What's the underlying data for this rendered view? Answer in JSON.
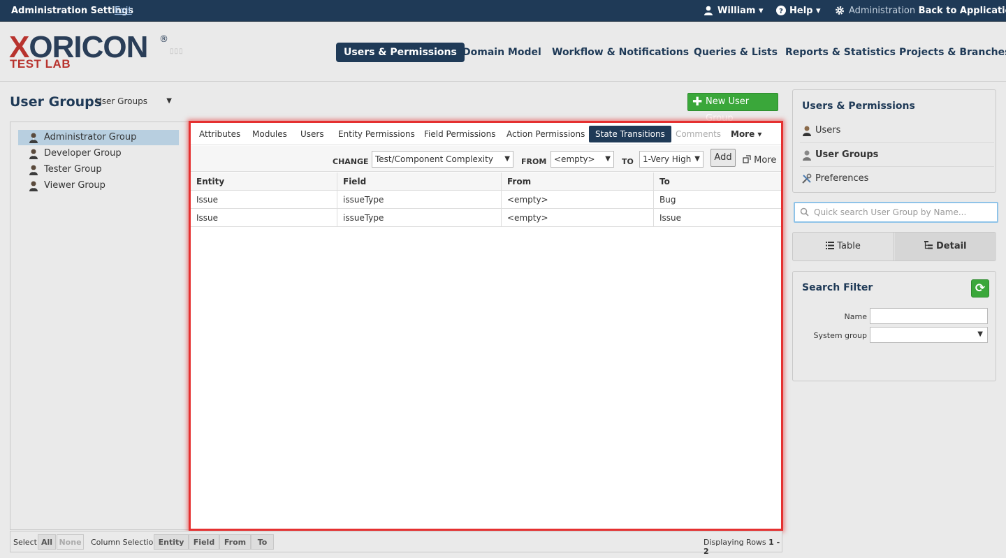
{
  "topbar": {
    "title": "Administration Settings",
    "exit": "Exit",
    "user": "William ▾",
    "help": "Help ▾",
    "admin_prefix": "Administration",
    "back": "Back to Application"
  },
  "logo": {
    "main": "XORICON",
    "reg": "®",
    "sub": "TEST LAB"
  },
  "nav": [
    {
      "label": "Users & Permissions",
      "active": true
    },
    {
      "label": "Domain Model"
    },
    {
      "label": "Workflow & Notifications"
    },
    {
      "label": "Queries & Lists"
    },
    {
      "label": "Reports & Statistics"
    },
    {
      "label": "Projects & Branches"
    }
  ],
  "page": {
    "title": "User Groups",
    "group_select": "User Groups",
    "new_button": "New User Group"
  },
  "groups": [
    {
      "name": "Administrator Group",
      "selected": true
    },
    {
      "name": "Developer Group"
    },
    {
      "name": "Tester Group"
    },
    {
      "name": "Viewer Group"
    }
  ],
  "tabs": [
    {
      "label": "Attributes"
    },
    {
      "label": "Modules"
    },
    {
      "label": "Users"
    },
    {
      "label": "Entity Permissions"
    },
    {
      "label": "Field Permissions"
    },
    {
      "label": "Action Permissions"
    },
    {
      "label": "State Transitions",
      "active": true
    },
    {
      "label": "Comments",
      "disabled": true
    },
    {
      "label": "More ▾"
    }
  ],
  "change": {
    "change_label": "CHANGE",
    "field_value": "Test/Component Complexity",
    "from_label": "FROM",
    "from_value": "<empty>",
    "to_label": "TO",
    "to_value": "1-Very High",
    "add": "Add",
    "more": "More"
  },
  "table": {
    "headers": [
      "Entity",
      "Field",
      "From",
      "To"
    ],
    "rows": [
      [
        "Issue",
        "issueType",
        "<empty>",
        "Bug"
      ],
      [
        "Issue",
        "issueType",
        "<empty>",
        "Issue"
      ]
    ]
  },
  "bottom": {
    "select_label": "Select",
    "all": "All",
    "none": "None",
    "column_label": "Column Selection:",
    "cols": [
      "Entity",
      "Field",
      "From",
      "To"
    ],
    "display_prefix": "Displaying Rows",
    "display_range": "1 - 2"
  },
  "right": {
    "title": "Users & Permissions",
    "items": [
      {
        "label": "Users"
      },
      {
        "label": "User Groups",
        "active": true
      },
      {
        "label": "Preferences"
      }
    ],
    "search_placeholder": "Quick search User Group by Name...",
    "view_table": "Table",
    "view_detail": "Detail",
    "filter_title": "Search Filter",
    "filter_name": "Name",
    "filter_system": "System group"
  },
  "colors": {
    "navy": "#1f3a57",
    "green": "#3aa73a",
    "brand_red": "#b8332e",
    "highlight": "#e53030"
  }
}
